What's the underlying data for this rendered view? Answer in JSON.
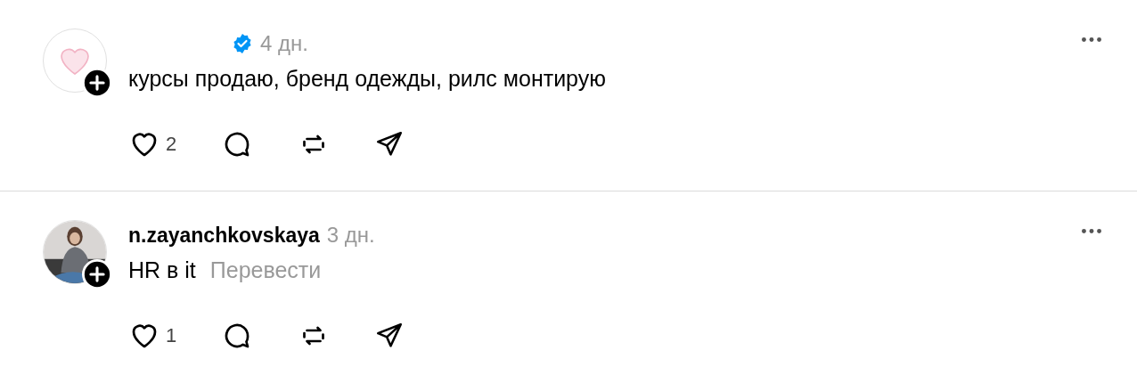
{
  "posts": [
    {
      "avatar": {
        "kind": "icon"
      },
      "verified": true,
      "time": "4 дн.",
      "text": "курсы продаю, бренд одежды, рилс монтирую",
      "likes": "2"
    },
    {
      "username": "n.zayanchkovskaya",
      "verified": false,
      "time": "3 дн.",
      "text": "HR в it",
      "translate": "Перевести",
      "likes": "1"
    }
  ]
}
